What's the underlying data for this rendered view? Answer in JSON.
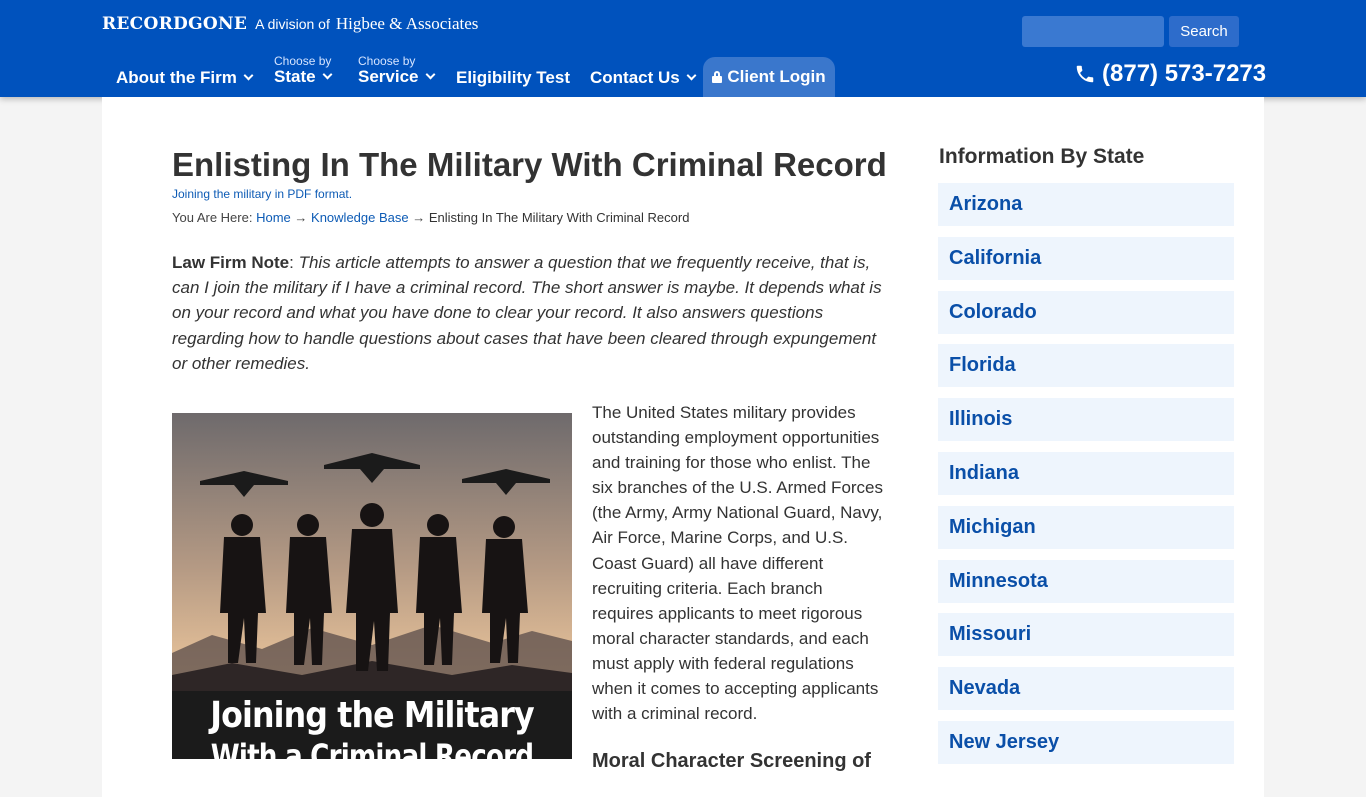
{
  "header": {
    "brand_name": "RECORDGONE",
    "brand_division": "A division of",
    "brand_partner": "Higbee & Associates",
    "search_placeholder": "",
    "search_button": "Search",
    "phone": "(877) 573-7273",
    "colors": {
      "header_bg": "#0052bd",
      "login_tab_bg": "#3a77cc"
    }
  },
  "nav": {
    "about": "About the Firm",
    "state_sub": "Choose by",
    "state": "State",
    "service_sub": "Choose by",
    "service": "Service",
    "eligibility": "Eligibility Test",
    "contact": "Contact Us",
    "login": "Client Login"
  },
  "article": {
    "title": "Enlisting In The Military With Criminal Record",
    "pdf_link": "Joining the military in PDF format.",
    "breadcrumb": {
      "prefix": "You Are Here:",
      "home": "Home",
      "sep": "→",
      "kb": "Knowledge Base",
      "current": "Enlisting In The Military With Criminal Record"
    },
    "note_label": "Law Firm Note",
    "note_colon": ":",
    "note_text": "This article attempts to answer a question that we frequently receive, that is, can I join the military if I have a criminal record. The short answer is maybe. It depends what is on your record and what you have done to clear your record. It also answers questions regarding how to handle questions about cases that have been cleared through expungement or other remedies.",
    "hero_caption_line1": "Joining the Military",
    "hero_caption_line2": "With a Criminal Record",
    "body": "The United States military provides outstanding employment opportunities and training for those who enlist. The six branches of the U.S. Armed Forces (the Army, Army National Guard, Navy, Air Force, Marine Corps, and U.S. Coast Guard) all have different recruiting criteria. Each branch requires applicants to meet rigorous moral character standards, and each must apply with federal regulations when it comes to accepting applicants with a criminal record.",
    "subhead": "Moral Character Screening of"
  },
  "sidebar": {
    "title": "Information By State",
    "states": [
      "Arizona",
      "California",
      "Colorado",
      "Florida",
      "Illinois",
      "Indiana",
      "Michigan",
      "Minnesota",
      "Missouri",
      "Nevada",
      "New Jersey"
    ]
  }
}
